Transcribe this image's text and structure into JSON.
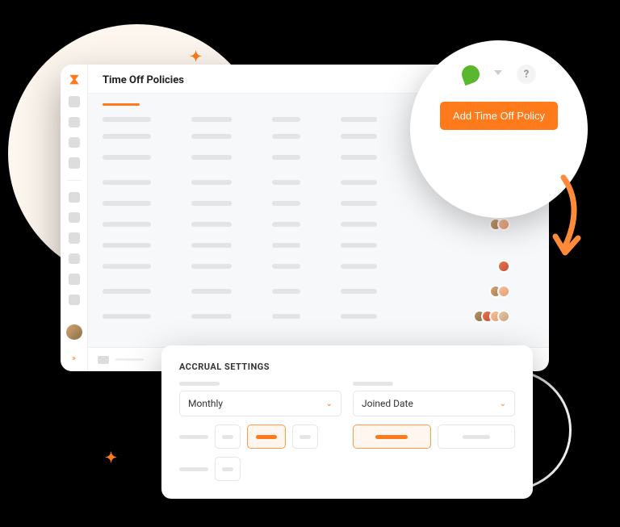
{
  "page": {
    "title": "Time Off Policies"
  },
  "bubble": {
    "help_symbol": "?",
    "add_button_label": "Add Time Off Policy"
  },
  "accrual": {
    "heading": "ACCRUAL SETTINGS",
    "frequency": {
      "selected": "Monthly"
    },
    "basis": {
      "selected": "Joined Date"
    }
  },
  "colors": {
    "accent": "#ff7a1a"
  }
}
